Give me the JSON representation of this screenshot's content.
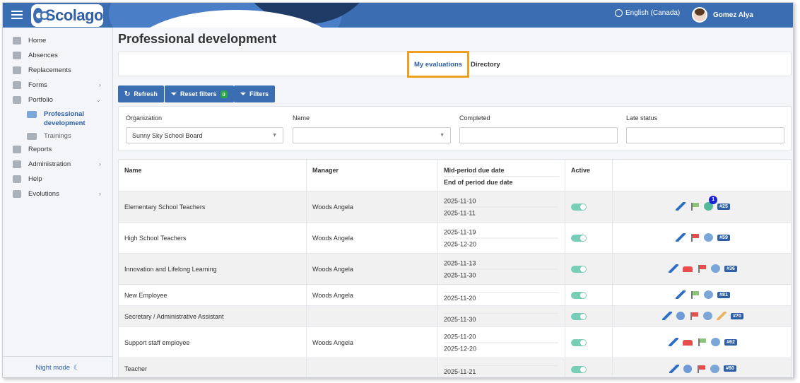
{
  "app": {
    "name": "Scolago",
    "language": "English (Canada)",
    "user": "Gomez Alya"
  },
  "sidebar": {
    "items": [
      {
        "label": "Home",
        "icon": "home-icon"
      },
      {
        "label": "Absences",
        "icon": "absences-icon"
      },
      {
        "label": "Replacements",
        "icon": "replacements-icon"
      },
      {
        "label": "Forms",
        "icon": "forms-icon",
        "chevron": "›"
      },
      {
        "label": "Portfolio",
        "icon": "trophy-icon",
        "chevron": "⌄"
      },
      {
        "label": "Professional development",
        "icon": "professional-development-icon",
        "active": true
      },
      {
        "label": "Trainings",
        "icon": "graduation-cap-icon"
      },
      {
        "label": "Reports",
        "icon": "reports-icon"
      },
      {
        "label": "Administration",
        "icon": "gear-icon",
        "chevron": "›"
      },
      {
        "label": "Help",
        "icon": "question-icon"
      },
      {
        "label": "Evolutions",
        "icon": "sprout-icon",
        "chevron": "›"
      }
    ],
    "night_mode": "Night mode"
  },
  "page": {
    "title": "Professional development"
  },
  "tabs": {
    "my_evaluations": "My evaluations",
    "directory": "Directory"
  },
  "toolbar": {
    "refresh": "Refresh",
    "reset_filters": "Reset filters",
    "reset_count": "0",
    "filters": "Filters"
  },
  "filters": {
    "organization_label": "Organization",
    "organization_value": "Sunny Sky School Board",
    "name_label": "Name",
    "name_value": "",
    "completed_label": "Completed",
    "completed_value": "",
    "late_status_label": "Late status",
    "late_status_value": ""
  },
  "table": {
    "headers": {
      "name": "Name",
      "manager": "Manager",
      "mid_due": "Mid-period due date",
      "end_due": "End of period due date",
      "active": "Active"
    },
    "rows": [
      {
        "name": "Elementary School Teachers",
        "manager": "Woods Angela",
        "mid": "2025-11-10",
        "end": "2025-11-11",
        "active": true,
        "num": "#25",
        "notif": "1"
      },
      {
        "name": "High School Teachers",
        "manager": "Woods Angela",
        "mid": "2025-11-19",
        "end": "2025-12-20",
        "active": true,
        "num": "#59"
      },
      {
        "name": "Innovation and Lifelong Learning",
        "manager": "Woods Angela",
        "mid": "2025-11-13",
        "end": "2025-11-30",
        "active": true,
        "num": "#36"
      },
      {
        "name": "New Employee",
        "manager": "Woods Angela",
        "mid": "",
        "end": "2025-11-20",
        "active": true,
        "num": "#81"
      },
      {
        "name": "Secretary / Administrative Assistant",
        "manager": "",
        "mid": "",
        "end": "2025-11-30",
        "active": true,
        "num": "#70"
      },
      {
        "name": "Support staff employee",
        "manager": "Woods Angela",
        "mid": "2025-11-20",
        "end": "2025-12-20",
        "active": true,
        "num": "#62"
      },
      {
        "name": "Teacher",
        "manager": "",
        "mid": "",
        "end": "2025-11-21",
        "active": true,
        "num": "#60"
      }
    ]
  }
}
